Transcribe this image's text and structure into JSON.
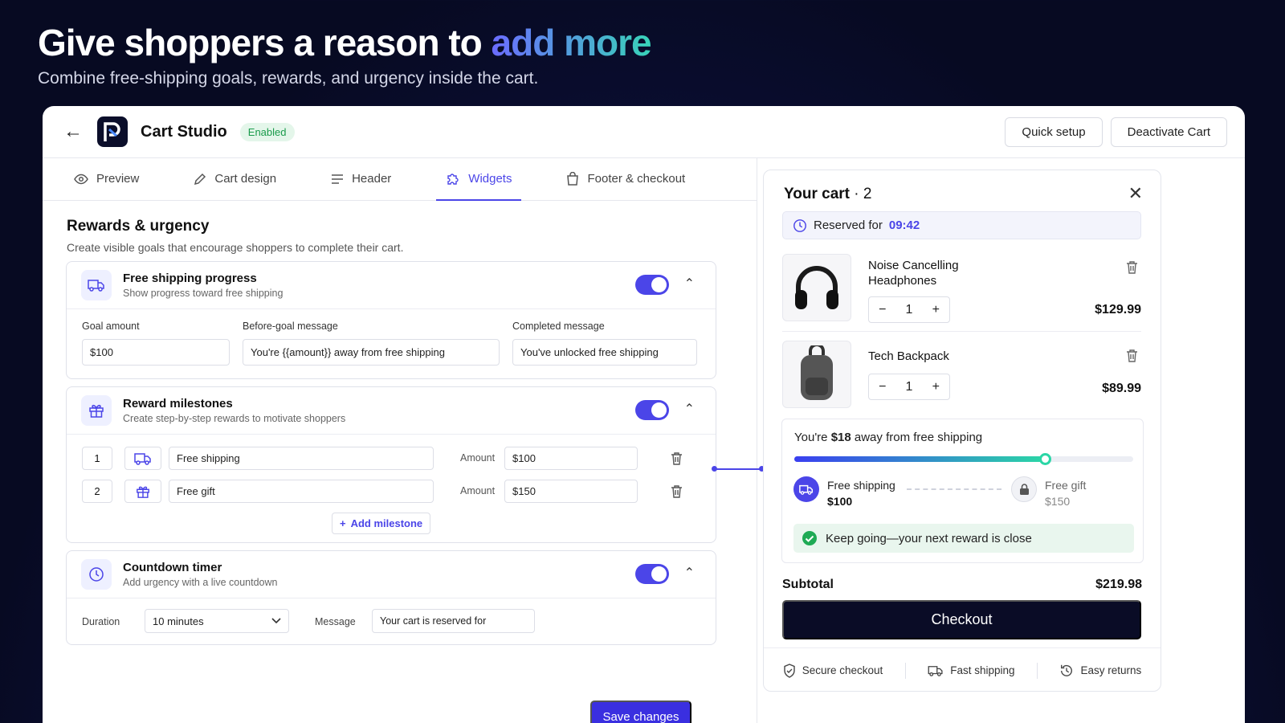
{
  "hero": {
    "title_plain": "Give shoppers a reason to ",
    "title_accent": "add more",
    "subtitle": "Combine free-shipping goals, rewards, and urgency inside the cart."
  },
  "app": {
    "name": "Cart Studio",
    "status": "Enabled",
    "quick_setup": "Quick setup",
    "deactivate": "Deactivate Cart"
  },
  "tabs": [
    {
      "label": "Preview"
    },
    {
      "label": "Cart design"
    },
    {
      "label": "Header"
    },
    {
      "label": "Widgets"
    },
    {
      "label": "Footer & checkout"
    }
  ],
  "active_tab": "Widgets",
  "section": {
    "title": "Rewards & urgency",
    "subtitle": "Create visible goals that encourage shoppers to complete their cart."
  },
  "free_shipping": {
    "title": "Free shipping progress",
    "subtitle": "Show progress toward free shipping",
    "enabled": true,
    "goal_label": "Goal amount",
    "goal_value": "$100",
    "before_label": "Before-goal message",
    "before_value": "You're {{amount}} away from free shipping",
    "completed_label": "Completed message",
    "completed_value": "You've unlocked free shipping"
  },
  "milestones": {
    "title": "Reward milestones",
    "subtitle": "Create step-by-step rewards to motivate shoppers",
    "enabled": true,
    "amount_label": "Amount",
    "items": [
      {
        "index": "1",
        "name": "Free shipping",
        "amount": "$100",
        "icon": "truck-icon"
      },
      {
        "index": "2",
        "name": "Free gift",
        "amount": "$150",
        "icon": "gift-icon"
      }
    ],
    "add_label": "Add milestone"
  },
  "countdown": {
    "title": "Countdown timer",
    "subtitle": "Add urgency with a live countdown",
    "enabled": true,
    "duration_label": "Duration",
    "duration_value": "10 minutes",
    "message_label": "Message",
    "message_value": "Your cart is reserved for"
  },
  "save_label": "Save changes",
  "cart": {
    "title": "Your cart",
    "count": "· 2",
    "reserved_label": "Reserved for",
    "reserved_time": "09:42",
    "items": [
      {
        "name": "Noise Cancelling Headphones",
        "qty": "1",
        "price": "$129.99"
      },
      {
        "name": "Tech Backpack",
        "qty": "1",
        "price": "$89.99"
      }
    ],
    "progress": {
      "prefix": "You're ",
      "amount": "$18",
      "suffix": " away from free shipping",
      "fraction": 0.74,
      "m1_label": "Free shipping",
      "m1_amount": "$100",
      "m2_label": "Free gift",
      "m2_amount": "$150"
    },
    "keep_going": "Keep going—your next reward is close",
    "subtotal_label": "Subtotal",
    "subtotal_value": "$219.98",
    "checkout_label": "Checkout",
    "footer": [
      {
        "label": "Secure checkout",
        "icon": "shield-icon"
      },
      {
        "label": "Fast shipping",
        "icon": "truck-icon"
      },
      {
        "label": "Easy returns",
        "icon": "history-icon"
      }
    ]
  },
  "colors": {
    "accent": "#4b45e8",
    "dark": "#0a0c26",
    "success": "#1a9b4b"
  }
}
